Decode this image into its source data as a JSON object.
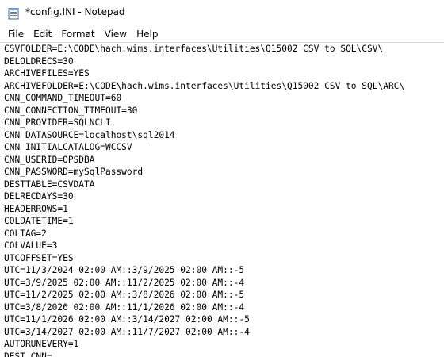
{
  "window": {
    "title": "*config.INI - Notepad",
    "app_icon": "notepad-icon"
  },
  "menu": {
    "items": [
      "File",
      "Edit",
      "Format",
      "View",
      "Help"
    ]
  },
  "editor": {
    "lines": [
      "CSVFOLDER=E:\\CODE\\hach.wims.interfaces\\Utilities\\Q15002 CSV to SQL\\CSV\\",
      "DELOLDRECS=30",
      "ARCHIVEFILES=YES",
      "ARCHIVEFOLDER=E:\\CODE\\hach.wims.interfaces\\Utilities\\Q15002 CSV to SQL\\ARC\\",
      "CNN_COMMAND_TIMEOUT=60",
      "CNN_CONNECTION_TIMEOUT=30",
      "CNN_PROVIDER=SQLNCLI",
      "CNN_DATASOURCE=localhost\\sql2014",
      "CNN_INITIALCATALOG=WCCSV",
      "CNN_USERID=OPSDBA",
      "CNN_PASSWORD=mySqlPassword",
      "DESTTABLE=CSVDATA",
      "DELRECDAYS=30",
      "HEADERROWS=1",
      "COLDATETIME=1",
      "COLTAG=2",
      "COLVALUE=3",
      "UTCOFFSET=YES",
      "UTC=11/3/2024 02:00 AM::3/9/2025 02:00 AM::-5",
      "UTC=3/9/2025 02:00 AM::11/2/2025 02:00 AM::-4",
      "UTC=11/2/2025 02:00 AM::3/8/2026 02:00 AM::-5",
      "UTC=3/8/2026 02:00 AM::11/1/2026 02:00 AM::-4",
      "UTC=11/1/2026 02:00 AM::3/14/2027 02:00 AM::-5",
      "UTC=3/14/2027 02:00 AM::11/7/2027 02:00 AM::-4",
      "AUTORUNEVERY=1",
      "DEST_CNN="
    ],
    "caret_line": 10
  }
}
